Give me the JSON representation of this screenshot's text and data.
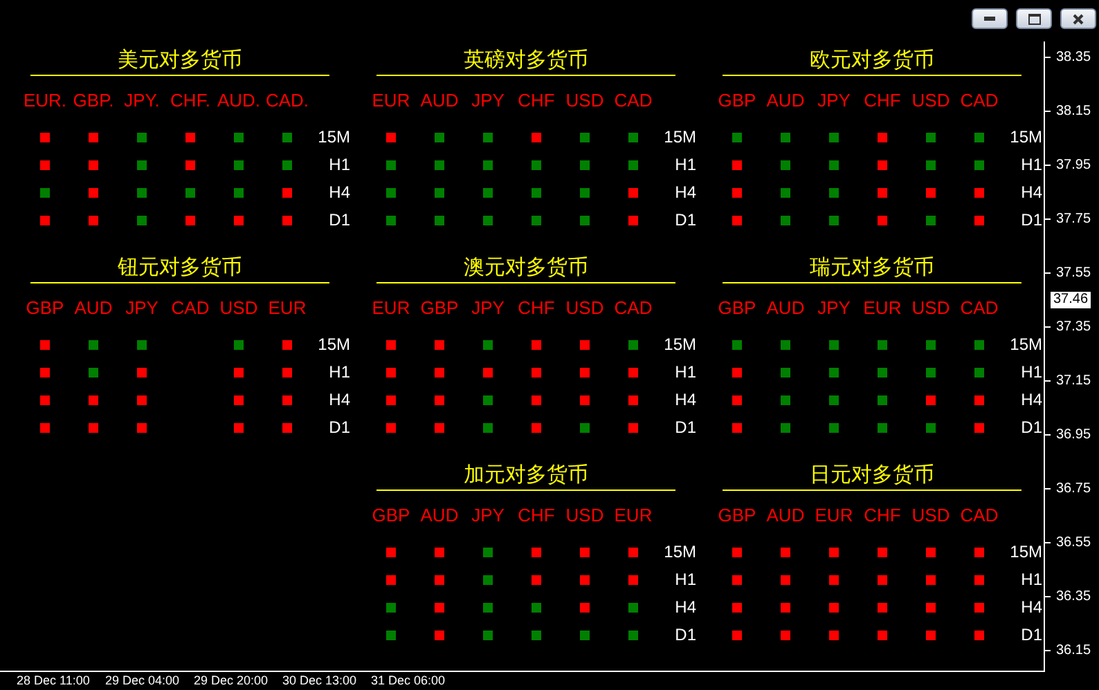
{
  "panels": [
    {
      "title": "美元对多货币",
      "currencies": [
        "EUR.",
        "GBP.",
        "JPY.",
        "CHF.",
        "AUD.",
        "CAD."
      ],
      "rows": [
        {
          "label": "15M",
          "cells": [
            {
              "color": "#ff0000"
            },
            {
              "color": "#ff0000"
            },
            {
              "color": "#008000"
            },
            {
              "color": "#ff0000"
            },
            {
              "color": "#008000"
            },
            {
              "color": "#008000"
            }
          ]
        },
        {
          "label": "H1",
          "cells": [
            {
              "color": "#ff0000"
            },
            {
              "color": "#ff0000"
            },
            {
              "color": "#008000"
            },
            {
              "color": "#ff0000"
            },
            {
              "color": "#008000"
            },
            {
              "color": "#008000"
            }
          ]
        },
        {
          "label": "H4",
          "cells": [
            {
              "color": "#008000"
            },
            {
              "color": "#ff0000"
            },
            {
              "color": "#008000"
            },
            {
              "color": "#008000"
            },
            {
              "color": "#008000"
            },
            {
              "color": "#ff0000"
            }
          ]
        },
        {
          "label": "D1",
          "cells": [
            {
              "color": "#ff0000"
            },
            {
              "color": "#ff0000"
            },
            {
              "color": "#008000"
            },
            {
              "color": "#ff0000"
            },
            {
              "color": "#ff0000"
            },
            {
              "color": "#ff0000"
            }
          ]
        }
      ]
    },
    {
      "title": "英磅对多货币",
      "currencies": [
        "EUR",
        "AUD",
        "JPY",
        "CHF",
        "USD",
        "CAD"
      ],
      "rows": [
        {
          "label": "15M",
          "cells": [
            {
              "color": "#ff0000"
            },
            {
              "color": "#008000"
            },
            {
              "color": "#008000"
            },
            {
              "color": "#ff0000"
            },
            {
              "color": "#008000"
            },
            {
              "color": "#008000"
            }
          ]
        },
        {
          "label": "H1",
          "cells": [
            {
              "color": "#008000"
            },
            {
              "color": "#008000"
            },
            {
              "color": "#008000"
            },
            {
              "color": "#008000"
            },
            {
              "color": "#008000"
            },
            {
              "color": "#008000"
            }
          ]
        },
        {
          "label": "H4",
          "cells": [
            {
              "color": "#008000"
            },
            {
              "color": "#008000"
            },
            {
              "color": "#008000"
            },
            {
              "color": "#008000"
            },
            {
              "color": "#008000"
            },
            {
              "color": "#ff0000"
            }
          ]
        },
        {
          "label": "D1",
          "cells": [
            {
              "color": "#008000"
            },
            {
              "color": "#008000"
            },
            {
              "color": "#008000"
            },
            {
              "color": "#008000"
            },
            {
              "color": "#008000"
            },
            {
              "color": "#ff0000"
            }
          ]
        }
      ]
    },
    {
      "title": "欧元对多货币",
      "currencies": [
        "GBP",
        "AUD",
        "JPY",
        "CHF",
        "USD",
        "CAD"
      ],
      "rows": [
        {
          "label": "15M",
          "cells": [
            {
              "color": "#008000"
            },
            {
              "color": "#008000"
            },
            {
              "color": "#008000"
            },
            {
              "color": "#ff0000"
            },
            {
              "color": "#008000"
            },
            {
              "color": "#008000"
            }
          ]
        },
        {
          "label": "H1",
          "cells": [
            {
              "color": "#ff0000"
            },
            {
              "color": "#008000"
            },
            {
              "color": "#008000"
            },
            {
              "color": "#ff0000"
            },
            {
              "color": "#008000"
            },
            {
              "color": "#008000"
            }
          ]
        },
        {
          "label": "H4",
          "cells": [
            {
              "color": "#ff0000"
            },
            {
              "color": "#008000"
            },
            {
              "color": "#008000"
            },
            {
              "color": "#ff0000"
            },
            {
              "color": "#ff0000"
            },
            {
              "color": "#ff0000"
            }
          ]
        },
        {
          "label": "D1",
          "cells": [
            {
              "color": "#ff0000"
            },
            {
              "color": "#008000"
            },
            {
              "color": "#008000"
            },
            {
              "color": "#ff0000"
            },
            {
              "color": "#008000"
            },
            {
              "color": "#ff0000"
            }
          ]
        }
      ]
    },
    {
      "title": "钮元对多货币",
      "currencies": [
        "GBP",
        "AUD",
        "JPY",
        "CAD",
        "USD",
        "EUR"
      ],
      "rows": [
        {
          "label": "15M",
          "cells": [
            {
              "color": "#ff0000"
            },
            {
              "color": "#008000"
            },
            {
              "color": "#008000"
            },
            null,
            {
              "color": "#008000"
            },
            {
              "color": "#ff0000"
            }
          ]
        },
        {
          "label": "H1",
          "cells": [
            {
              "color": "#ff0000"
            },
            {
              "color": "#008000"
            },
            {
              "color": "#ff0000"
            },
            null,
            {
              "color": "#ff0000"
            },
            {
              "color": "#ff0000"
            }
          ]
        },
        {
          "label": "H4",
          "cells": [
            {
              "color": "#ff0000"
            },
            {
              "color": "#ff0000"
            },
            {
              "color": "#ff0000"
            },
            null,
            {
              "color": "#ff0000"
            },
            {
              "color": "#ff0000"
            }
          ]
        },
        {
          "label": "D1",
          "cells": [
            {
              "color": "#ff0000"
            },
            {
              "color": "#ff0000"
            },
            {
              "color": "#ff0000"
            },
            null,
            {
              "color": "#ff0000"
            },
            {
              "color": "#ff0000"
            }
          ]
        }
      ]
    },
    {
      "title": "澳元对多货币",
      "currencies": [
        "EUR",
        "GBP",
        "JPY",
        "CHF",
        "USD",
        "CAD"
      ],
      "rows": [
        {
          "label": "15M",
          "cells": [
            {
              "color": "#ff0000"
            },
            {
              "color": "#ff0000"
            },
            {
              "color": "#008000"
            },
            {
              "color": "#ff0000"
            },
            {
              "color": "#ff0000"
            },
            {
              "color": "#008000"
            }
          ]
        },
        {
          "label": "H1",
          "cells": [
            {
              "color": "#ff0000"
            },
            {
              "color": "#ff0000"
            },
            {
              "color": "#ff0000"
            },
            {
              "color": "#ff0000"
            },
            {
              "color": "#ff0000"
            },
            {
              "color": "#ff0000"
            }
          ]
        },
        {
          "label": "H4",
          "cells": [
            {
              "color": "#ff0000"
            },
            {
              "color": "#ff0000"
            },
            {
              "color": "#008000"
            },
            {
              "color": "#ff0000"
            },
            {
              "color": "#ff0000"
            },
            {
              "color": "#ff0000"
            }
          ]
        },
        {
          "label": "D1",
          "cells": [
            {
              "color": "#ff0000"
            },
            {
              "color": "#ff0000"
            },
            {
              "color": "#008000"
            },
            {
              "color": "#ff0000"
            },
            {
              "color": "#008000"
            },
            {
              "color": "#ff0000"
            }
          ]
        }
      ]
    },
    {
      "title": "瑞元对多货币",
      "currencies": [
        "GBP",
        "AUD",
        "JPY",
        "EUR",
        "USD",
        "CAD"
      ],
      "rows": [
        {
          "label": "15M",
          "cells": [
            {
              "color": "#008000"
            },
            {
              "color": "#008000"
            },
            {
              "color": "#008000"
            },
            {
              "color": "#008000"
            },
            {
              "color": "#008000"
            },
            {
              "color": "#008000"
            }
          ]
        },
        {
          "label": "H1",
          "cells": [
            {
              "color": "#ff0000"
            },
            {
              "color": "#008000"
            },
            {
              "color": "#008000"
            },
            {
              "color": "#008000"
            },
            {
              "color": "#008000"
            },
            {
              "color": "#008000"
            }
          ]
        },
        {
          "label": "H4",
          "cells": [
            {
              "color": "#ff0000"
            },
            {
              "color": "#008000"
            },
            {
              "color": "#008000"
            },
            {
              "color": "#008000"
            },
            {
              "color": "#ff0000"
            },
            {
              "color": "#ff0000"
            }
          ]
        },
        {
          "label": "D1",
          "cells": [
            {
              "color": "#ff0000"
            },
            {
              "color": "#008000"
            },
            {
              "color": "#008000"
            },
            {
              "color": "#008000"
            },
            {
              "color": "#008000"
            },
            {
              "color": "#ff0000"
            }
          ]
        }
      ]
    },
    {
      "title": "加元对多货币",
      "currencies": [
        "GBP",
        "AUD",
        "JPY",
        "CHF",
        "USD",
        "EUR"
      ],
      "rows": [
        {
          "label": "15M",
          "cells": [
            {
              "color": "#ff0000"
            },
            {
              "color": "#ff0000"
            },
            {
              "color": "#008000"
            },
            {
              "color": "#ff0000"
            },
            {
              "color": "#ff0000"
            },
            {
              "color": "#ff0000"
            }
          ]
        },
        {
          "label": "H1",
          "cells": [
            {
              "color": "#ff0000"
            },
            {
              "color": "#ff0000"
            },
            {
              "color": "#008000"
            },
            {
              "color": "#ff0000"
            },
            {
              "color": "#ff0000"
            },
            {
              "color": "#ff0000"
            }
          ]
        },
        {
          "label": "H4",
          "cells": [
            {
              "color": "#008000"
            },
            {
              "color": "#ff0000"
            },
            {
              "color": "#008000"
            },
            {
              "color": "#008000"
            },
            {
              "color": "#ff0000"
            },
            {
              "color": "#008000"
            }
          ]
        },
        {
          "label": "D1",
          "cells": [
            {
              "color": "#008000"
            },
            {
              "color": "#ff0000"
            },
            {
              "color": "#008000"
            },
            {
              "color": "#008000"
            },
            {
              "color": "#008000"
            },
            {
              "color": "#008000"
            }
          ]
        }
      ]
    },
    {
      "title": "日元对多货币",
      "currencies": [
        "GBP",
        "AUD",
        "EUR",
        "CHF",
        "USD",
        "CAD"
      ],
      "rows": [
        {
          "label": "15M",
          "cells": [
            {
              "color": "#ff0000"
            },
            {
              "color": "#ff0000"
            },
            {
              "color": "#ff0000"
            },
            {
              "color": "#ff0000"
            },
            {
              "color": "#ff0000"
            },
            {
              "color": "#ff0000"
            }
          ]
        },
        {
          "label": "H1",
          "cells": [
            {
              "color": "#ff0000"
            },
            {
              "color": "#ff0000"
            },
            {
              "color": "#ff0000"
            },
            {
              "color": "#ff0000"
            },
            {
              "color": "#ff0000"
            },
            {
              "color": "#ff0000"
            }
          ]
        },
        {
          "label": "H4",
          "cells": [
            {
              "color": "#ff0000"
            },
            {
              "color": "#ff0000"
            },
            {
              "color": "#ff0000"
            },
            {
              "color": "#ff0000"
            },
            {
              "color": "#ff0000"
            },
            {
              "color": "#ff0000"
            }
          ]
        },
        {
          "label": "D1",
          "cells": [
            {
              "color": "#ff0000"
            },
            {
              "color": "#ff0000"
            },
            {
              "color": "#ff0000"
            },
            {
              "color": "#ff0000"
            },
            {
              "color": "#ff0000"
            },
            {
              "color": "#ff0000"
            }
          ]
        }
      ]
    }
  ],
  "price_axis": {
    "ticks": [
      "38.35",
      "38.15",
      "37.95",
      "37.75",
      "37.55",
      "37.35",
      "37.15",
      "36.95",
      "36.75",
      "36.55",
      "36.35",
      "36.15"
    ],
    "current_price": "37.46"
  },
  "time_axis": {
    "ticks": [
      "28 Dec 11:00",
      "29 Dec 04:00",
      "29 Dec 20:00",
      "30 Dec 13:00",
      "31 Dec 06:00"
    ]
  }
}
